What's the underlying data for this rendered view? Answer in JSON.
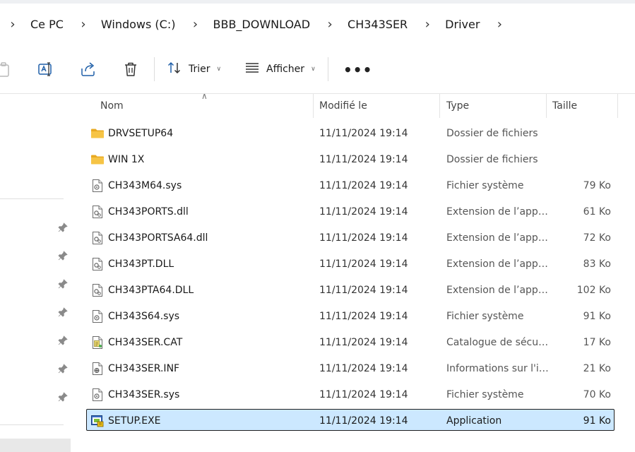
{
  "breadcrumb": {
    "items": [
      {
        "label": "Ce PC"
      },
      {
        "label": "Windows (C:)"
      },
      {
        "label": "BBB_DOWNLOAD"
      },
      {
        "label": "CH343SER"
      },
      {
        "label": "Driver"
      }
    ]
  },
  "toolbar": {
    "sort_label": "Trier",
    "view_label": "Afficher",
    "icons": [
      "paste-icon",
      "rename-icon",
      "share-icon",
      "delete-icon",
      "sort-icon",
      "view-icon",
      "more-icon"
    ]
  },
  "columns": {
    "name": "Nom",
    "modified": "Modifié le",
    "type": "Type",
    "size": "Taille"
  },
  "files": [
    {
      "name": "DRVSETUP64",
      "modified": "11/11/2024 19:14",
      "type": "Dossier de fichiers",
      "size": "",
      "icon": "folder-icon"
    },
    {
      "name": "WIN 1X",
      "modified": "11/11/2024 19:14",
      "type": "Dossier de fichiers",
      "size": "",
      "icon": "folder-icon"
    },
    {
      "name": "CH343M64.sys",
      "modified": "11/11/2024 19:14",
      "type": "Fichier système",
      "size": "79 Ko",
      "icon": "system-file-icon"
    },
    {
      "name": "CH343PORTS.dll",
      "modified": "11/11/2024 19:14",
      "type": "Extension de l’app…",
      "size": "61 Ko",
      "icon": "dll-file-icon"
    },
    {
      "name": "CH343PORTSA64.dll",
      "modified": "11/11/2024 19:14",
      "type": "Extension de l’app…",
      "size": "72 Ko",
      "icon": "dll-file-icon"
    },
    {
      "name": "CH343PT.DLL",
      "modified": "11/11/2024 19:14",
      "type": "Extension de l’app…",
      "size": "83 Ko",
      "icon": "dll-file-icon"
    },
    {
      "name": "CH343PTA64.DLL",
      "modified": "11/11/2024 19:14",
      "type": "Extension de l’app…",
      "size": "102 Ko",
      "icon": "dll-file-icon"
    },
    {
      "name": "CH343S64.sys",
      "modified": "11/11/2024 19:14",
      "type": "Fichier système",
      "size": "91 Ko",
      "icon": "system-file-icon"
    },
    {
      "name": "CH343SER.CAT",
      "modified": "11/11/2024 19:14",
      "type": "Catalogue de sécu…",
      "size": "17 Ko",
      "icon": "catalog-file-icon"
    },
    {
      "name": "CH343SER.INF",
      "modified": "11/11/2024 19:14",
      "type": "Informations sur l'i…",
      "size": "21 Ko",
      "icon": "setup-info-file-icon"
    },
    {
      "name": "CH343SER.sys",
      "modified": "11/11/2024 19:14",
      "type": "Fichier système",
      "size": "70 Ko",
      "icon": "system-file-icon"
    },
    {
      "name": "SETUP.EXE",
      "modified": "11/11/2024 19:14",
      "type": "Application",
      "size": "91 Ko",
      "icon": "application-icon",
      "selected": true
    }
  ],
  "colors": {
    "selection_fill": "#cce8ff",
    "folder": "#f6c445",
    "accent": "#0067c0"
  }
}
